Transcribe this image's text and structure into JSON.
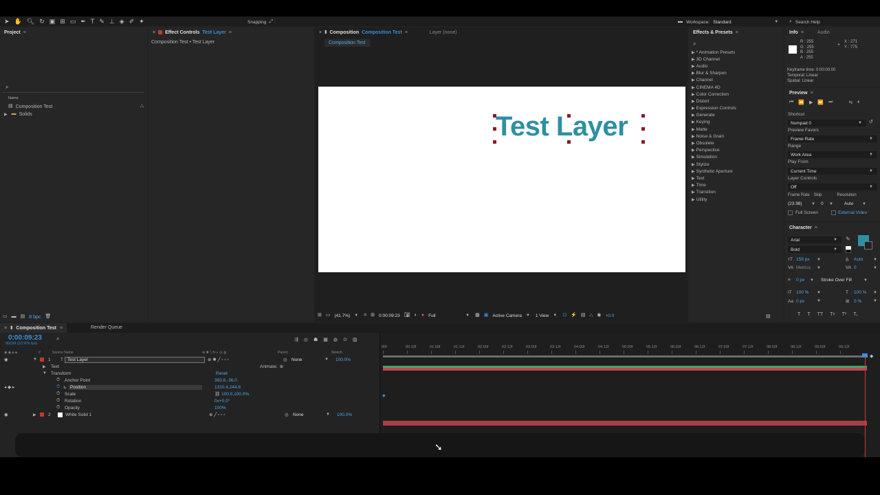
{
  "toolbar": {
    "snapping_label": "Snapping",
    "workspace_label": "Workspace:",
    "workspace_value": "Standard",
    "search_help_placeholder": "Search Help"
  },
  "project": {
    "tab": "Project",
    "name_header": "Name",
    "items": [
      {
        "label": "Composition Test",
        "icon": "composition-icon"
      },
      {
        "label": "Solids",
        "icon": "folder-icon"
      }
    ],
    "bpc": "8 bpc"
  },
  "effect_controls": {
    "tab_prefix": "Effect Controls",
    "tab_layer": "Test Layer",
    "breadcrumb": "Composition Test • Test Layer"
  },
  "composition": {
    "tab_prefix": "Composition",
    "tab_name": "Composition Test",
    "layer_tab": "Layer (none)",
    "subtab": "Composition Test",
    "canvas_text": "Test Layer",
    "text_color": "#2e8fa3",
    "zoom": "(41.7%)",
    "timecode": "0:00:09:23",
    "resolution": "Full",
    "camera": "Active Camera",
    "views": "1 View",
    "exposure": "+0.0"
  },
  "effects_presets": {
    "tab": "Effects & Presets",
    "items": [
      "* Animation Presets",
      "3D Channel",
      "Audio",
      "Blur & Sharpen",
      "Channel",
      "CINEMA 4D",
      "Color Correction",
      "Distort",
      "Expression Controls",
      "Generate",
      "Keying",
      "Matte",
      "Noise & Grain",
      "Obsolete",
      "Perspective",
      "Simulation",
      "Stylize",
      "Synthetic Aperture",
      "Text",
      "Time",
      "Transition",
      "Utility"
    ]
  },
  "info": {
    "tab": "Info",
    "audio_tab": "Audio",
    "r": "R : 255",
    "g": "G : 255",
    "b": "B : 255",
    "a": "A : 255",
    "x": "X : 271",
    "y": "Y : 775",
    "keyframe_time": "Keyframe time: 0:00:00:00",
    "temporal": "Temporal: Linear",
    "spatial": "Spatial: Linear"
  },
  "preview": {
    "tab": "Preview",
    "shortcut_label": "Shortcut",
    "shortcut_value": "Numpad 0",
    "favors_label": "Preview Favors",
    "favors_value": "Frame Rate",
    "range_label": "Range",
    "range_value": "Work Area",
    "play_from_label": "Play From",
    "play_from_value": "Current Time",
    "layer_controls_label": "Layer Controls",
    "layer_controls_value": "Off",
    "frame_rate_label": "Frame Rate",
    "skip_label": "Skip",
    "resolution_label": "Resolution",
    "frame_rate_value": "(23.98)",
    "skip_value": "0",
    "resolution_value": "Auto",
    "full_screen": "Full Screen",
    "external_video": "External Video"
  },
  "character": {
    "tab": "Character",
    "font": "Arial",
    "style": "Bold",
    "fill_color": "#2e8fa3",
    "size": "158 px",
    "leading": "Auto",
    "kerning": "Metrics",
    "tracking": "0",
    "stroke_width": "0 px",
    "stroke_type": "Stroke Over Fill",
    "vert_scale": "100 %",
    "horiz_scale": "100 %",
    "baseline": "0 px",
    "tsume": "0 %"
  },
  "timeline": {
    "tab": "Composition Test",
    "render_queue_tab": "Render Queue",
    "timecode": "0:00:09:23",
    "frames": "00239 (23.976 fps)",
    "headers": {
      "num": "#",
      "source": "Source Name",
      "parent": "Parent",
      "stretch": "Stretch"
    },
    "ruler": [
      "00f",
      "00:12f",
      "01:00f",
      "01:12f",
      "02:00f",
      "02:12f",
      "03:00f",
      "03:12f",
      "04:00f",
      "04:12f",
      "05:00f",
      "05:12f",
      "06:00f",
      "06:12f",
      "07:00f",
      "07:12f",
      "08:00f",
      "08:12f",
      "09:00f",
      "09:12f"
    ],
    "layers": [
      {
        "num": "1",
        "name": "Test Layer",
        "parent": "None",
        "stretch": "100.0%",
        "label_color": "#c0392b"
      },
      {
        "num": "2",
        "name": "White Solid 1",
        "parent": "None",
        "stretch": "100.0%",
        "label_color": "#c0392b"
      }
    ],
    "animate_label": "Animate:",
    "text_group": "Text",
    "transform_group": "Transform",
    "reset_label": "Reset",
    "properties": [
      {
        "name": "Anchor Point",
        "value": "393.6,-36.0"
      },
      {
        "name": "Position",
        "value": "1310.4,244.8"
      },
      {
        "name": "Scale",
        "value": "100.0,100.0%"
      },
      {
        "name": "Rotation",
        "value": "0x+0.0°"
      },
      {
        "name": "Opacity",
        "value": "100%"
      }
    ]
  }
}
